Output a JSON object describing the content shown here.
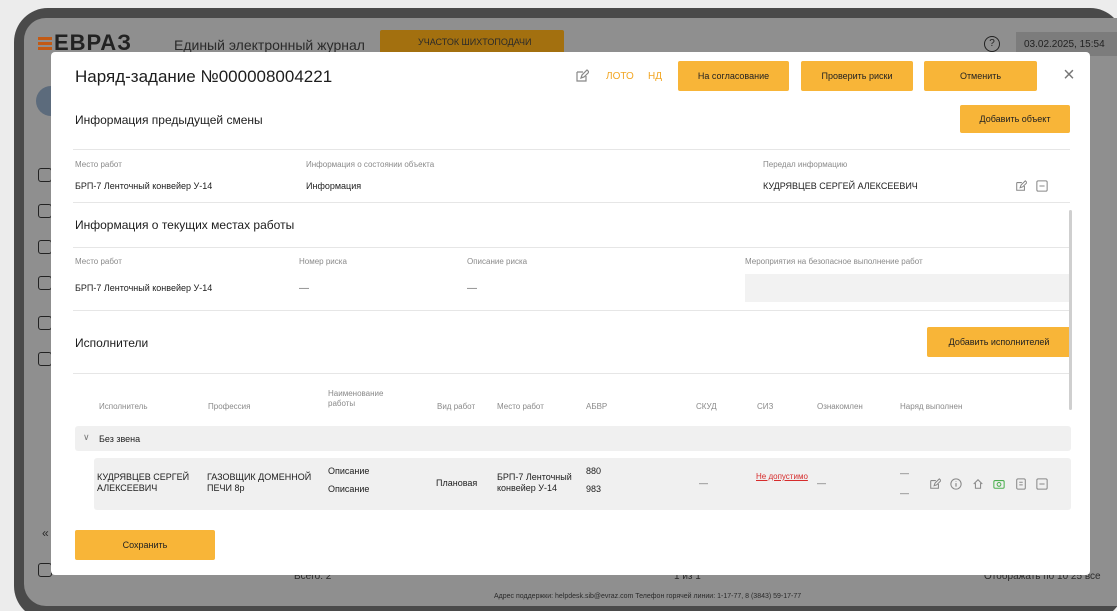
{
  "background": {
    "logo": "ЕВРАЗ",
    "app_title": "Единый электронный журнал",
    "area_button": "УЧАСТОК ШИХТОПОДАЧИ",
    "datetime": "03.02.2025, 15:54",
    "total": "Всего: 2",
    "pagination": "1 из 1",
    "show": "Отображать по 10 25 все",
    "footer": "Адрес поддержки: helpdesk.sib@evraz.com Телефон горячей линии: 1-17-77, 8 (3843) 59-17-77"
  },
  "modal": {
    "title": "Наряд-задание №000008004221",
    "tags": {
      "loto": "ЛОТО",
      "nd": "НД"
    },
    "buttons": {
      "approve": "На согласование",
      "check_risks": "Проверить риски",
      "cancel": "Отменить",
      "add_object": "Добавить объект",
      "add_executor": "Добавить исполнителей",
      "save": "Сохранить"
    },
    "prev_shift": {
      "title": "Информация предыдущей смены",
      "labels": {
        "place": "Место работ",
        "object_state": "Информация о состоянии объекта",
        "passed_by": "Передал информацию"
      },
      "values": {
        "place": "БРП-7 Ленточный конвейер У-14",
        "object_state": "Информация",
        "passed_by": "КУДРЯВЦЕВ СЕРГЕЙ АЛЕКСЕЕВИЧ"
      }
    },
    "current_places": {
      "title": "Информация о текущих местах работы",
      "labels": {
        "place": "Место работ",
        "risk_number": "Номер риска",
        "risk_desc": "Описание риска",
        "measures": "Мероприятия на безопасное выполнение работ"
      },
      "values": {
        "place": "БРП-7 Ленточный конвейер У-14",
        "risk_number": "—",
        "risk_desc": "—"
      }
    },
    "executors": {
      "title": "Исполнители",
      "columns": [
        "Исполнитель",
        "Профессия",
        "Наименование работы",
        "Вид работ",
        "Место работ",
        "АБВР",
        "СКУД",
        "СИЗ",
        "Ознакомлен",
        "Наряд выполнен"
      ],
      "group": "Без звена",
      "row": {
        "executor": "КУДРЯВЦЕВ СЕРГЕЙ АЛЕКСЕЕВИЧ",
        "profession": "ГАЗОВЩИК ДОМЕННОЙ ПЕЧИ 8р",
        "work_name_1": "Описание",
        "work_name_2": "Описание",
        "work_type": "Плановая",
        "place": "БРП-7 Ленточный конвейер У-14",
        "abvr_1": "880",
        "abvr_2": "983",
        "skud": "—",
        "siz": "Не допустимо",
        "familiarized": "—",
        "done_1": "—",
        "done_2": "—"
      }
    }
  },
  "colors": {
    "accent": "#f8b538",
    "accent_text": "#f2a623",
    "danger": "#d62b2b"
  }
}
